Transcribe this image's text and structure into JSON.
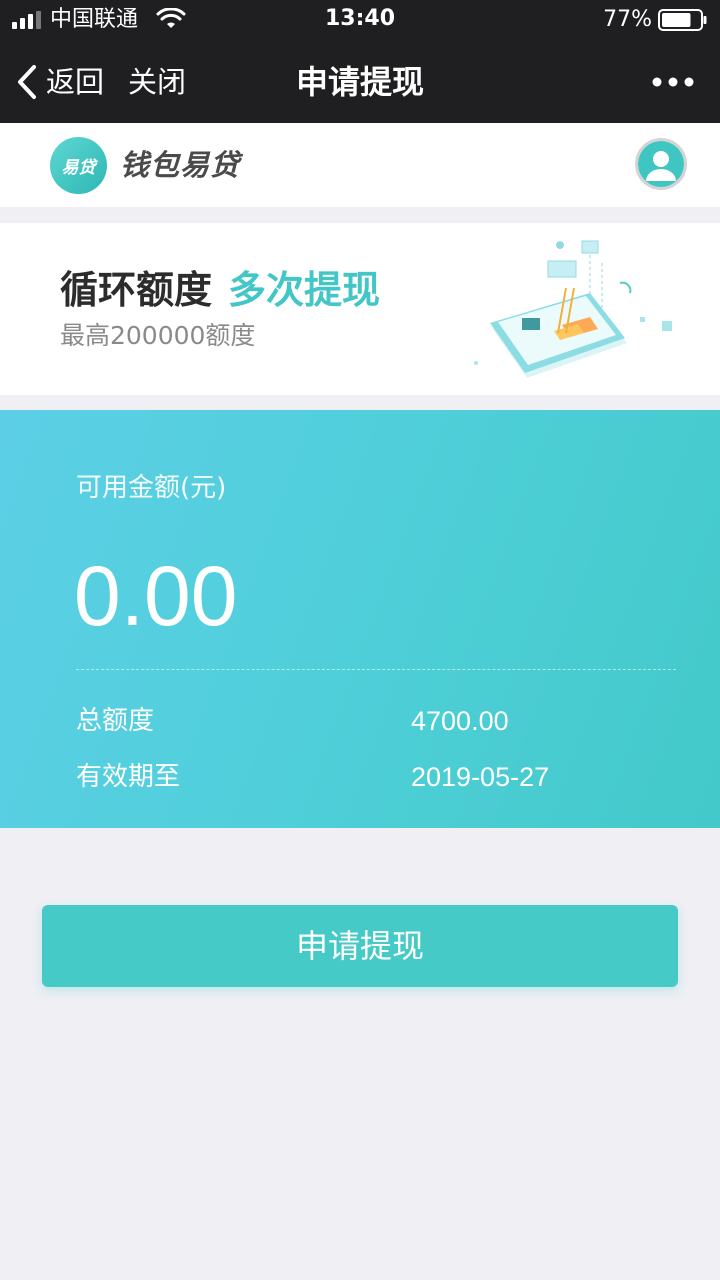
{
  "status_bar": {
    "carrier": "中国联通",
    "time": "13:40",
    "battery_percent": "77%",
    "battery_level": 0.77,
    "icons": [
      "signal-icon",
      "wifi-icon",
      "battery-icon"
    ]
  },
  "nav": {
    "back_label": "返回",
    "close_label": "关闭",
    "title": "申请提现",
    "icons": [
      "chevron-left-icon",
      "more-icon"
    ]
  },
  "brand": {
    "logo_text": "易贷",
    "name": "钱包易贷",
    "icons": [
      "brand-logo-icon",
      "user-avatar-icon"
    ]
  },
  "banner": {
    "title": "循环额度",
    "title_accent": "多次提现",
    "subtitle": "最高200000额度"
  },
  "card": {
    "available_label": "可用金额(元)",
    "available_amount": "0.00",
    "total_label": "总额度",
    "total_value": "4700.00",
    "expiry_label": "有效期至",
    "expiry_value": "2019-05-27"
  },
  "actions": {
    "apply_label": "申请提现"
  },
  "colors": {
    "accent": "#45cac7",
    "nav_bg": "#1f1f21",
    "page_bg": "#efeff4",
    "card_gradient_start": "#5ccfe6",
    "card_gradient_end": "#43c9c9"
  }
}
